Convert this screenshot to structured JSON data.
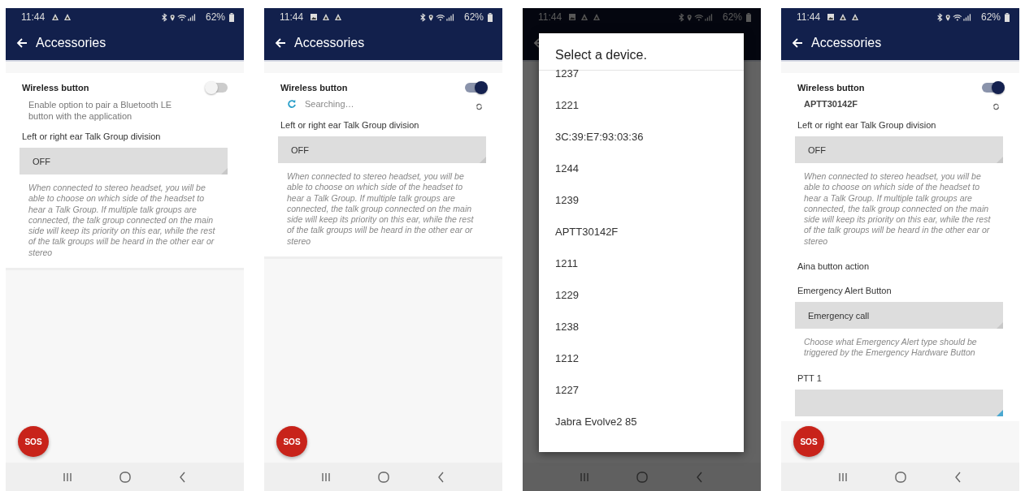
{
  "phones": [
    {
      "status": {
        "time": "11:44",
        "battery": "62%",
        "notifications": [
          {
            "kind": "triangle"
          },
          {
            "kind": "triangle"
          }
        ]
      },
      "title": "Accessories",
      "dimmed": false,
      "card_ends": true,
      "sos": "SOS",
      "items": [
        {
          "kind": "toggle",
          "label": "Wireless button",
          "on": false
        },
        {
          "kind": "description",
          "text": "Enable option to pair a Bluetooth LE button with the application"
        },
        {
          "kind": "label",
          "text": "Left or right ear Talk Group division"
        },
        {
          "kind": "dropdown",
          "value": "OFF",
          "accent": false
        },
        {
          "kind": "note",
          "text": "When connected to stereo headset, you will be able to choose on which side of the headset to hear a Talk Group. If multiple talk groups are connected, the talk group connected on the main side will keep its priority on this ear, while the rest of the talk groups will be heard in the other ear or stereo"
        }
      ]
    },
    {
      "status": {
        "time": "11:44",
        "battery": "62%",
        "notifications": [
          {
            "kind": "image"
          },
          {
            "kind": "triangle"
          },
          {
            "kind": "triangle"
          }
        ]
      },
      "title": "Accessories",
      "dimmed": false,
      "card_ends": true,
      "sos": "SOS",
      "items": [
        {
          "kind": "toggle",
          "label": "Wireless button",
          "on": true
        },
        {
          "kind": "searching",
          "text": "Searching…"
        },
        {
          "kind": "label",
          "text": "Left or right ear Talk Group division"
        },
        {
          "kind": "dropdown",
          "value": "OFF",
          "accent": false
        },
        {
          "kind": "note",
          "text": "When connected to stereo headset, you will be able to choose on which side of the headset to hear a Talk Group. If multiple talk groups are connected, the talk group connected on the main side will keep its priority on this ear, while the rest of the talk groups will be heard in the other ear or stereo"
        }
      ]
    },
    {
      "status": {
        "time": "11:44",
        "battery": "62%",
        "notifications": [
          {
            "kind": "image"
          },
          {
            "kind": "triangle"
          },
          {
            "kind": "triangle"
          }
        ]
      },
      "dimmed": true,
      "dialog": {
        "title": "Select a device.",
        "devices": [
          "1237",
          "1221",
          "3C:39:E7:93:03:36",
          "1244",
          "1239",
          "APTT30142F",
          "1211",
          "1229",
          "1238",
          "1212",
          "1227",
          "Jabra Evolve2 85"
        ]
      }
    },
    {
      "status": {
        "time": "11:44",
        "battery": "62%",
        "notifications": [
          {
            "kind": "image"
          },
          {
            "kind": "triangle"
          },
          {
            "kind": "triangle"
          }
        ]
      },
      "title": "Accessories",
      "dimmed": false,
      "card_ends": false,
      "sos": "SOS",
      "items": [
        {
          "kind": "toggle",
          "label": "Wireless button",
          "on": true
        },
        {
          "kind": "device",
          "text": "APTT30142F"
        },
        {
          "kind": "label",
          "text": "Left or right ear Talk Group division"
        },
        {
          "kind": "dropdown",
          "value": "OFF",
          "accent": false
        },
        {
          "kind": "note",
          "text": "When connected to stereo headset, you will be able to choose on which side of the headset to hear a Talk Group. If multiple talk groups are connected, the talk group connected on the main side will keep its priority on this ear, while the rest of the talk groups will be heard in the other ear or stereo"
        },
        {
          "kind": "label",
          "text": "Aina button action"
        },
        {
          "kind": "label",
          "text": "Emergency Alert Button"
        },
        {
          "kind": "dropdown",
          "value": "Emergency call",
          "accent": false
        },
        {
          "kind": "note",
          "text": "Choose what Emergency Alert type should be triggered by the Emergency Hardware Button"
        },
        {
          "kind": "label",
          "text": "PTT 1"
        },
        {
          "kind": "dropdown",
          "accent": true
        }
      ]
    }
  ]
}
